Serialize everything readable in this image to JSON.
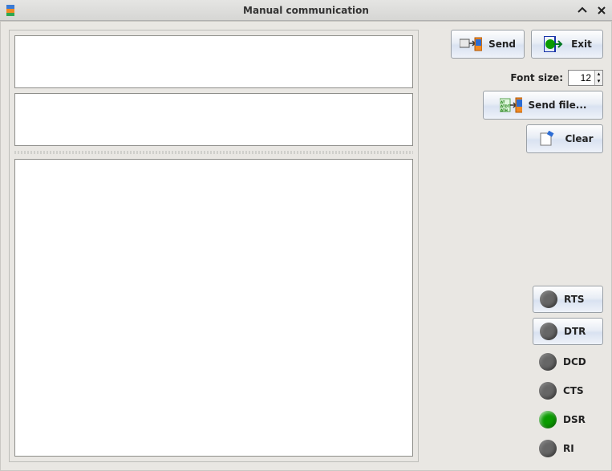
{
  "window": {
    "title": "Manual communication"
  },
  "buttons": {
    "send": "Send",
    "exit": "Exit",
    "send_file": "Send file...",
    "clear": "Clear"
  },
  "font": {
    "label": "Font size:",
    "value": "12"
  },
  "inputs": {
    "tx": "",
    "echo": "",
    "rx": ""
  },
  "signals": {
    "rts": {
      "label": "RTS",
      "on": false,
      "toggle": true
    },
    "dtr": {
      "label": "DTR",
      "on": false,
      "toggle": true
    },
    "dcd": {
      "label": "DCD",
      "on": false,
      "toggle": false
    },
    "cts": {
      "label": "CTS",
      "on": false,
      "toggle": false
    },
    "dsr": {
      "label": "DSR",
      "on": true,
      "toggle": false
    },
    "ri": {
      "label": "RI",
      "on": false,
      "toggle": false
    }
  }
}
